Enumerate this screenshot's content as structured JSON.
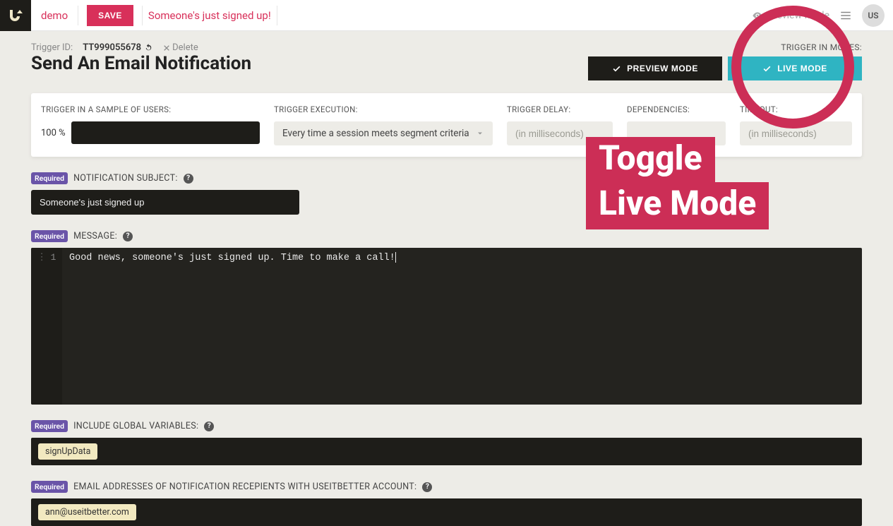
{
  "topbar": {
    "workspace": "demo",
    "save_label": "SAVE",
    "doc_title": "Someone's just signed up!",
    "preview_label": "Preview Mode",
    "avatar": "US"
  },
  "meta": {
    "trigger_id_label": "Trigger ID:",
    "trigger_id_value": "TT999055678",
    "delete_label": "Delete"
  },
  "page_title": "Send An Email Notification",
  "modes": {
    "label": "TRIGGER IN MODES:",
    "preview": "PREVIEW MODE",
    "live": "LIVE MODE"
  },
  "config": {
    "sample_label": "TRIGGER IN A SAMPLE OF USERS:",
    "sample_pct": "100 %",
    "exec_label": "TRIGGER EXECUTION:",
    "exec_value": "Every time a session meets segment criteria",
    "delay_label": "TRIGGER DELAY:",
    "delay_placeholder": "(in milliseconds)",
    "deps_label": "DEPENDENCIES:",
    "timeout_label": "TIMEOUT:",
    "timeout_placeholder": "(in milliseconds)"
  },
  "required_label": "Required",
  "subject": {
    "label": "NOTIFICATION SUBJECT:",
    "value": "Someone's just signed up"
  },
  "message": {
    "label": "MESSAGE:",
    "line_no": "1",
    "code": "Good news, someone's just signed up. Time to make a call!"
  },
  "globals": {
    "label": "INCLUDE GLOBAL VARIABLES:",
    "pill": "signUpData"
  },
  "recipients": {
    "label": "EMAIL ADDRESSES OF NOTIFICATION RECEPIENTS WITH USEITBETTER ACCOUNT:",
    "pill": "ann@useitbetter.com"
  },
  "annotation": {
    "line1": "Toggle",
    "line2": "Live Mode"
  }
}
